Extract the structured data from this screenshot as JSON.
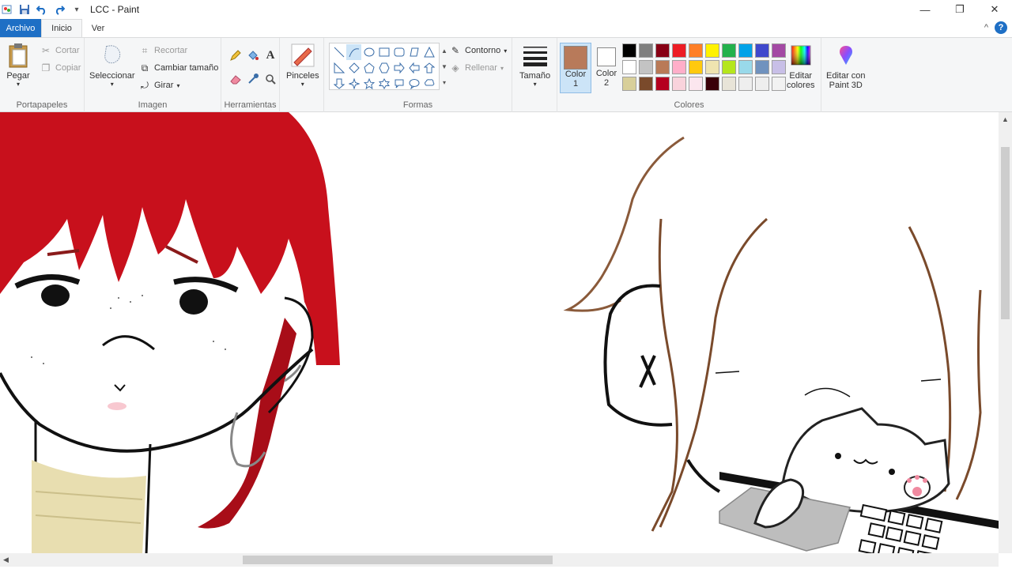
{
  "window": {
    "title": "LCC - Paint",
    "minimize_glyph": "—",
    "restore_glyph": "❐",
    "close_glyph": "✕"
  },
  "quick_access": {
    "app_icon": "paint-app-icon",
    "save_icon": "save-icon",
    "undo_icon": "undo-icon",
    "redo_icon": "redo-icon",
    "customize_glyph": "▾"
  },
  "tabs": {
    "file": "Archivo",
    "home": "Inicio",
    "view": "Ver",
    "collapse_glyph": "^",
    "help_glyph": "?"
  },
  "ribbon": {
    "clipboard": {
      "label": "Portapapeles",
      "paste": "Pegar",
      "cut": "Cortar",
      "copy": "Copiar"
    },
    "image": {
      "label": "Imagen",
      "select": "Seleccionar",
      "crop": "Recortar",
      "resize": "Cambiar tamaño",
      "rotate": "Girar"
    },
    "tools": {
      "label": "Herramientas"
    },
    "brushes": {
      "label": "Pinceles"
    },
    "shapes": {
      "label": "Formas",
      "outline": "Contorno",
      "fill": "Rellenar"
    },
    "size": {
      "label": "Tamaño"
    },
    "colors": {
      "label": "Colores",
      "color1_label": "Color",
      "color1_num": "1",
      "color2_label": "Color",
      "color2_num": "2",
      "edit_colors_1": "Editar",
      "edit_colors_2": "colores",
      "color1_value": "#b87a5a",
      "color2_value": "#ffffff",
      "palette": [
        "#000000",
        "#7f7f7f",
        "#880015",
        "#ed1c24",
        "#ff7f27",
        "#fff200",
        "#22b14c",
        "#00a2e8",
        "#3f48cc",
        "#a349a4",
        "#ffffff",
        "#c3c3c3",
        "#b97a57",
        "#ffaec9",
        "#ffc90e",
        "#efe4b0",
        "#b5e61d",
        "#99d9ea",
        "#7092be",
        "#c8bfe7",
        "#d8cf9a",
        "#7a4a2b",
        "#b5001f",
        "#f9d3dc",
        "#fbe6ee",
        "#3a0008",
        "#e8e4d8",
        "#eeeeee",
        "#eeeeee",
        "#f2f2f2"
      ]
    },
    "paint3d": {
      "line1": "Editar con",
      "line2": "Paint 3D"
    }
  }
}
